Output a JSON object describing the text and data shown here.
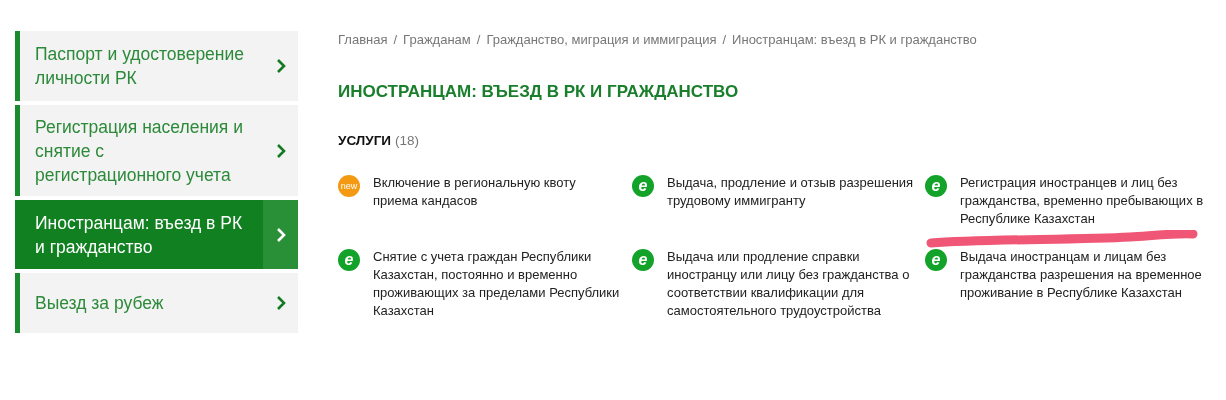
{
  "sidebar": {
    "items": [
      {
        "label": "Паспорт и удостоверение личности РК",
        "selected": false
      },
      {
        "label": "Регистрация населения и снятие с регистрационного учета",
        "selected": false
      },
      {
        "label": "Иностранцам: въезд в РК и гражданство",
        "selected": true
      },
      {
        "label": "Выезд за рубеж",
        "selected": false
      }
    ]
  },
  "breadcrumbs": [
    "Главная",
    "Гражданам",
    "Гражданство, миграция и иммиграция",
    "Иностранцам: въезд в РК и гражданство"
  ],
  "breadcrumb_separator": "/",
  "page_title": "ИНОСТРАНЦАМ: ВЪЕЗД В РК И ГРАЖДАНСТВО",
  "services": {
    "heading": "УСЛУГИ",
    "count": "(18)",
    "items": [
      {
        "kind": "new",
        "badge": "new",
        "text": "Включение в региональную квоту приема кандасов"
      },
      {
        "kind": "electronic",
        "badge": "e",
        "text": "Выдача, продление и отзыв разрешения трудовому иммигранту"
      },
      {
        "kind": "electronic",
        "badge": "e",
        "text": "Регистрация иностранцев и лиц без гражданства, временно пребывающих в Республике Казахстан",
        "highlighted": true
      },
      {
        "kind": "electronic",
        "badge": "e",
        "text": "Снятие с учета граждан Республики Казахстан, постоянно и временно проживающих за пределами Республики Казахстан"
      },
      {
        "kind": "electronic",
        "badge": "e",
        "text": "Выдача или продление справки иностранцу или лицу без гражданства о соответствии квалификации для самостоятельного трудоустройства"
      },
      {
        "kind": "electronic",
        "badge": "e",
        "text": "Выдача иностранцам и лицам без гражданства разрешения на временное проживание в Республике Казахстан"
      }
    ]
  }
}
